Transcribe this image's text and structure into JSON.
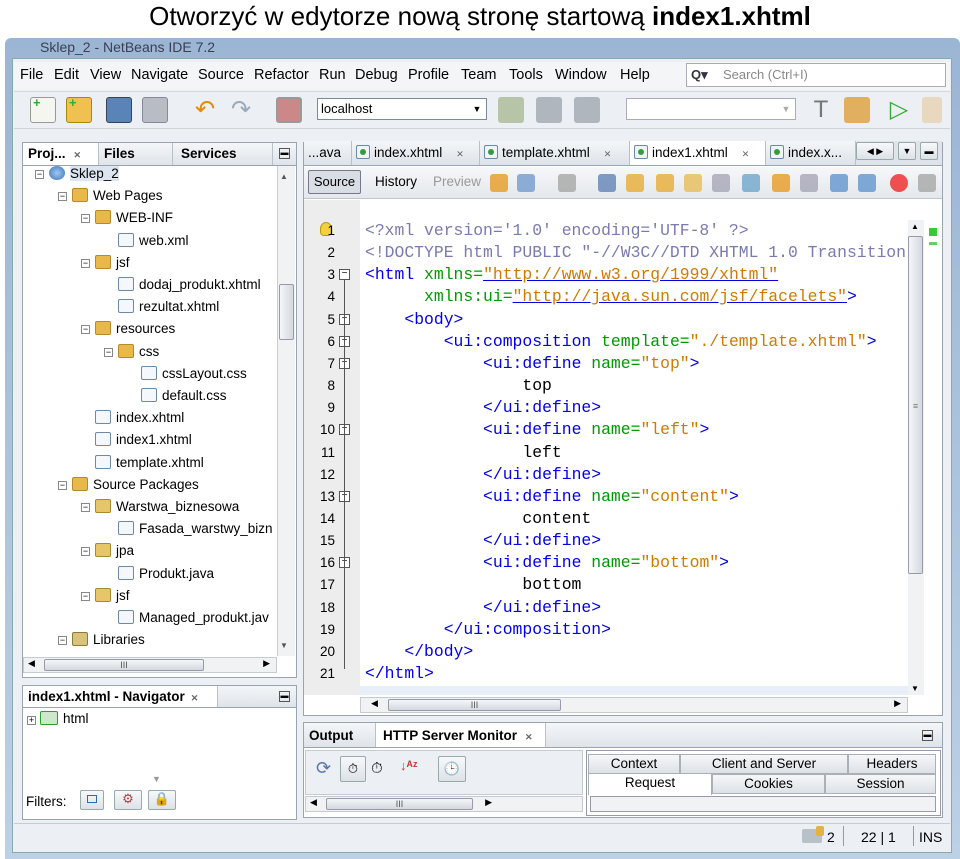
{
  "heading": {
    "prefix": "Otworzyć w edytorze nową stronę startową ",
    "bold": "index1.xhtml"
  },
  "window_title": "Sklep_2 - NetBeans IDE 7.2",
  "menu": [
    "File",
    "Edit",
    "View",
    "Navigate",
    "Source",
    "Refactor",
    "Run",
    "Debug",
    "Profile",
    "Team",
    "Tools",
    "Window",
    "Help"
  ],
  "search": {
    "placeholder": "Search (Ctrl+I)"
  },
  "toolbar": {
    "server_combo": "localhost",
    "config_combo": ""
  },
  "projects_panel": {
    "tabs": [
      "Proj...",
      "Files",
      "Services"
    ],
    "tree": [
      {
        "label": "Sklep_2",
        "icon": "project-globe",
        "depth": 0
      },
      {
        "label": "Web Pages",
        "icon": "folder",
        "depth": 1
      },
      {
        "label": "WEB-INF",
        "icon": "folder",
        "depth": 2
      },
      {
        "label": "web.xml",
        "icon": "xml-file",
        "depth": 3
      },
      {
        "label": "jsf",
        "icon": "folder",
        "depth": 2
      },
      {
        "label": "dodaj_produkt.xhtml",
        "icon": "xhtml-file",
        "depth": 3
      },
      {
        "label": "rezultat.xhtml",
        "icon": "xhtml-file",
        "depth": 3
      },
      {
        "label": "resources",
        "icon": "folder",
        "depth": 2
      },
      {
        "label": "css",
        "icon": "folder",
        "depth": 3
      },
      {
        "label": "cssLayout.css",
        "icon": "css-file",
        "depth": 4
      },
      {
        "label": "default.css",
        "icon": "css-file",
        "depth": 4
      },
      {
        "label": "index.xhtml",
        "icon": "xhtml-file",
        "depth": 2
      },
      {
        "label": "index1.xhtml",
        "icon": "xhtml-file",
        "depth": 2
      },
      {
        "label": "template.xhtml",
        "icon": "xhtml-file",
        "depth": 2
      },
      {
        "label": "Source Packages",
        "icon": "folder",
        "depth": 1
      },
      {
        "label": "Warstwa_biznesowa",
        "icon": "package",
        "depth": 2
      },
      {
        "label": "Fasada_warstwy_bizn",
        "icon": "java-file",
        "depth": 3
      },
      {
        "label": "jpa",
        "icon": "package",
        "depth": 2
      },
      {
        "label": "Produkt.java",
        "icon": "java-file",
        "depth": 3
      },
      {
        "label": "jsf",
        "icon": "package",
        "depth": 2
      },
      {
        "label": "Managed_produkt.jav",
        "icon": "java-file",
        "depth": 3
      },
      {
        "label": "Libraries",
        "icon": "library",
        "depth": 1
      }
    ]
  },
  "navigator": {
    "title": "index1.xhtml - Navigator",
    "root": "html",
    "filters_label": "Filters:"
  },
  "editor": {
    "tabs": [
      {
        "label": "...ava",
        "active": false
      },
      {
        "label": "index.xhtml",
        "active": false
      },
      {
        "label": "template.xhtml",
        "active": false
      },
      {
        "label": "index1.xhtml",
        "active": true
      },
      {
        "label": "index.x...",
        "active": false
      }
    ],
    "views": [
      "Source",
      "History",
      "Preview"
    ],
    "colors": {
      "tag": "#0000e6",
      "attr": "#009900",
      "value": "#ce7b00",
      "pi": "#7a7ab0",
      "text": "#000000"
    },
    "lines": [
      [
        [
          "pi",
          "<?xml version='1.0' encoding='UTF-8' ?>"
        ]
      ],
      [
        [
          "pi",
          "<!DOCTYPE html PUBLIC \"-//W3C//DTD XHTML 1.0 Transition"
        ]
      ],
      [
        [
          "tag",
          "<html "
        ],
        [
          "attr",
          "xmlns="
        ],
        [
          "value",
          "\"http://www.w3.org/1999/xhtml\""
        ]
      ],
      [
        [
          "text",
          "      "
        ],
        [
          "attr",
          "xmlns:ui="
        ],
        [
          "value",
          "\"http://java.sun.com/jsf/facelets\""
        ],
        [
          "tag",
          ">"
        ]
      ],
      [
        [
          "text",
          "    "
        ],
        [
          "tag",
          "<body>"
        ]
      ],
      [
        [
          "text",
          "        "
        ],
        [
          "tag",
          "<ui:composition "
        ],
        [
          "attr",
          "template="
        ],
        [
          "value",
          "\"./template.xhtml\""
        ],
        [
          "tag",
          ">"
        ]
      ],
      [
        [
          "text",
          "            "
        ],
        [
          "tag",
          "<ui:define "
        ],
        [
          "attr",
          "name="
        ],
        [
          "value",
          "\"top\""
        ],
        [
          "tag",
          ">"
        ]
      ],
      [
        [
          "text",
          "                top"
        ]
      ],
      [
        [
          "text",
          "            "
        ],
        [
          "tag",
          "</ui:define>"
        ]
      ],
      [
        [
          "text",
          "            "
        ],
        [
          "tag",
          "<ui:define "
        ],
        [
          "attr",
          "name="
        ],
        [
          "value",
          "\"left\""
        ],
        [
          "tag",
          ">"
        ]
      ],
      [
        [
          "text",
          "                left"
        ]
      ],
      [
        [
          "text",
          "            "
        ],
        [
          "tag",
          "</ui:define>"
        ]
      ],
      [
        [
          "text",
          "            "
        ],
        [
          "tag",
          "<ui:define "
        ],
        [
          "attr",
          "name="
        ],
        [
          "value",
          "\"content\""
        ],
        [
          "tag",
          ">"
        ]
      ],
      [
        [
          "text",
          "                content"
        ]
      ],
      [
        [
          "text",
          "            "
        ],
        [
          "tag",
          "</ui:define>"
        ]
      ],
      [
        [
          "text",
          "            "
        ],
        [
          "tag",
          "<ui:define "
        ],
        [
          "attr",
          "name="
        ],
        [
          "value",
          "\"bottom\""
        ],
        [
          "tag",
          ">"
        ]
      ],
      [
        [
          "text",
          "                bottom"
        ]
      ],
      [
        [
          "text",
          "            "
        ],
        [
          "tag",
          "</ui:define>"
        ]
      ],
      [
        [
          "text",
          "        "
        ],
        [
          "tag",
          "</ui:composition>"
        ]
      ],
      [
        [
          "text",
          "    "
        ],
        [
          "tag",
          "</body>"
        ]
      ],
      [
        [
          "tag",
          "</html>"
        ]
      ]
    ],
    "line_numbers": [
      "1",
      "2",
      "3",
      "4",
      "5",
      "6",
      "7",
      "8",
      "9",
      "10",
      "11",
      "12",
      "13",
      "14",
      "15",
      "16",
      "17",
      "18",
      "19",
      "20",
      "21"
    ],
    "folds": [
      3,
      5,
      6,
      7,
      10,
      13,
      16
    ]
  },
  "output_panel": {
    "tabs": [
      "Output",
      "HTTP Server Monitor"
    ],
    "detail_tabs_row1": [
      "Context",
      "Client and Server",
      "Headers"
    ],
    "detail_tabs_row2": [
      "Request",
      "Cookies",
      "Session"
    ]
  },
  "status": {
    "tasks": "2",
    "position": "22 | 1",
    "mode": "INS"
  }
}
